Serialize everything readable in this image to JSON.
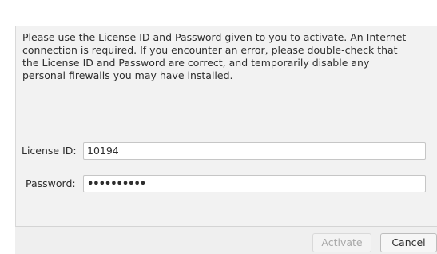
{
  "dialog": {
    "message": "Please use the License ID and Password given to you to activate.  An Internet\nconnection is required.  If you encounter an error, please double-check that\nthe License ID and Password are correct, and temporarily disable any\npersonal firewalls you may have installed.",
    "license_label": "License ID:",
    "license_value": "10194",
    "password_label": "Password:",
    "password_masked": "••••••••••",
    "activate_label": "Activate",
    "cancel_label": "Cancel"
  },
  "colors": {
    "panel_bg": "#f2f2f2",
    "field_bg": "#ffffff",
    "disabled_text": "#a8a8a8"
  }
}
